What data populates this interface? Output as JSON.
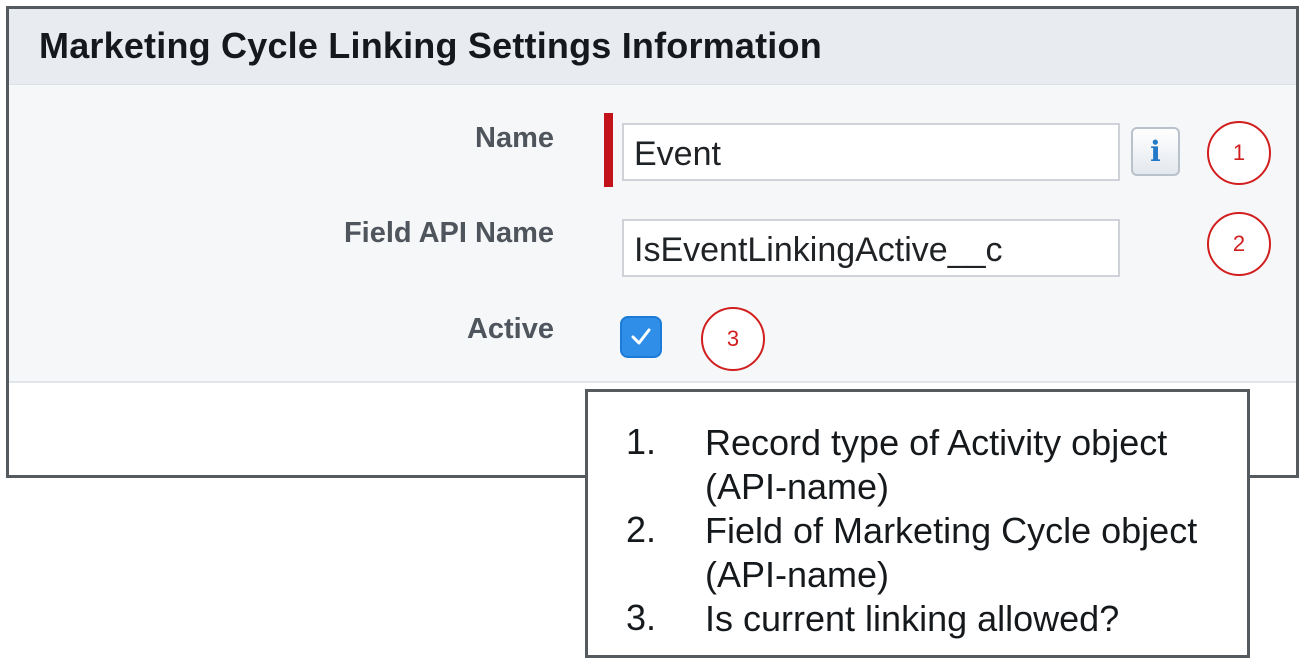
{
  "panel": {
    "title": "Marketing Cycle Linking Settings Information",
    "fields": [
      {
        "label": "Name",
        "value": "Event",
        "required": true
      },
      {
        "label": "Field API Name",
        "value": "IsEventLinkingActive__c"
      },
      {
        "label": "Active",
        "checked": true
      }
    ],
    "info_button_glyph": "i"
  },
  "callouts": [
    "1",
    "2",
    "3"
  ],
  "legend": {
    "items": [
      {
        "num": "1.",
        "text": "Record type of Activity object (API-name)"
      },
      {
        "num": "2.",
        "text": "Field of Marketing Cycle object (API-name)"
      },
      {
        "num": "3.",
        "text": "Is current linking allowed?"
      }
    ]
  },
  "colors": {
    "required_marker": "#c2131b",
    "callout": "#d11e1e",
    "checkbox": "#2f8ee8",
    "header_bg": "#e8ebf0"
  }
}
